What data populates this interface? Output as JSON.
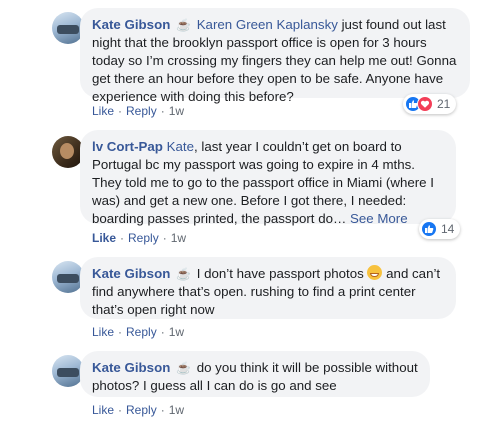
{
  "comments": [
    {
      "author": "Kate Gibson",
      "coffee": "☕",
      "mention": "Karen Green Kaplansky",
      "text": " just found out last night that the brooklyn passport office is open for 3 hours today so I’m crossing my fingers they can help me out! Gonna get there an hour before they open to be safe. Anyone have experience with doing this before?",
      "like_label": "Like",
      "reply_label": "Reply",
      "time": "1w",
      "reaction_count": "21",
      "reaction_icons": [
        "like-icon",
        "love-icon"
      ]
    },
    {
      "author": "lv Cort-Pap",
      "mention": "Kate",
      "text": ", last year I couldn’t get on board to Portugal bc my passport was going to expire in 4 mths. They told me to go to the passport office in Miami (where I was) and get a new one. Before I got there, I needed: boarding passes printed, the passport do…",
      "see_more": "See More",
      "like_label": "Like",
      "reply_label": "Reply",
      "time": "1w",
      "reaction_count": "14",
      "reaction_icons": [
        "like-icon"
      ]
    },
    {
      "author": "Kate Gibson",
      "coffee": "☕",
      "text_before_emoji": " I don’t have passport photos ",
      "emoji": "grinning-sweat-emoji",
      "text_after_emoji": " and can’t find anywhere that’s open. rushing to find a print center that’s open right now",
      "like_label": "Like",
      "reply_label": "Reply",
      "time": "1w"
    },
    {
      "author": "Kate Gibson",
      "coffee": "☕",
      "text": " do you think it will be possible without photos? I guess all I can do is go and see",
      "like_label": "Like",
      "reply_label": "Reply",
      "time": "1w"
    }
  ],
  "separator": "·",
  "colors": {
    "link": "#385898",
    "bubble": "#f2f3f5",
    "like": "#1877f2",
    "love": "#f33e58"
  }
}
